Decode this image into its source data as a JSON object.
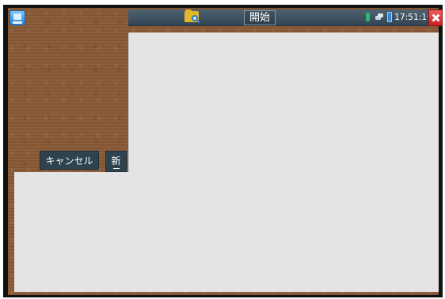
{
  "header": {
    "title": "開始",
    "time": "17:51:10"
  },
  "actions": {
    "cancel_label": "キャンセル",
    "new_label": "新"
  },
  "icons": {
    "app": "app-icon",
    "folder": "folder-search-icon",
    "close": "close-icon",
    "status_indicator": "status-indicator-icon",
    "device": "device-icon",
    "battery": "battery-icon"
  },
  "colors": {
    "topbar": "#3f5260",
    "panel": "#e4e4e4",
    "button": "#2f4250",
    "close": "#d93030",
    "background": "#8a5a36"
  }
}
